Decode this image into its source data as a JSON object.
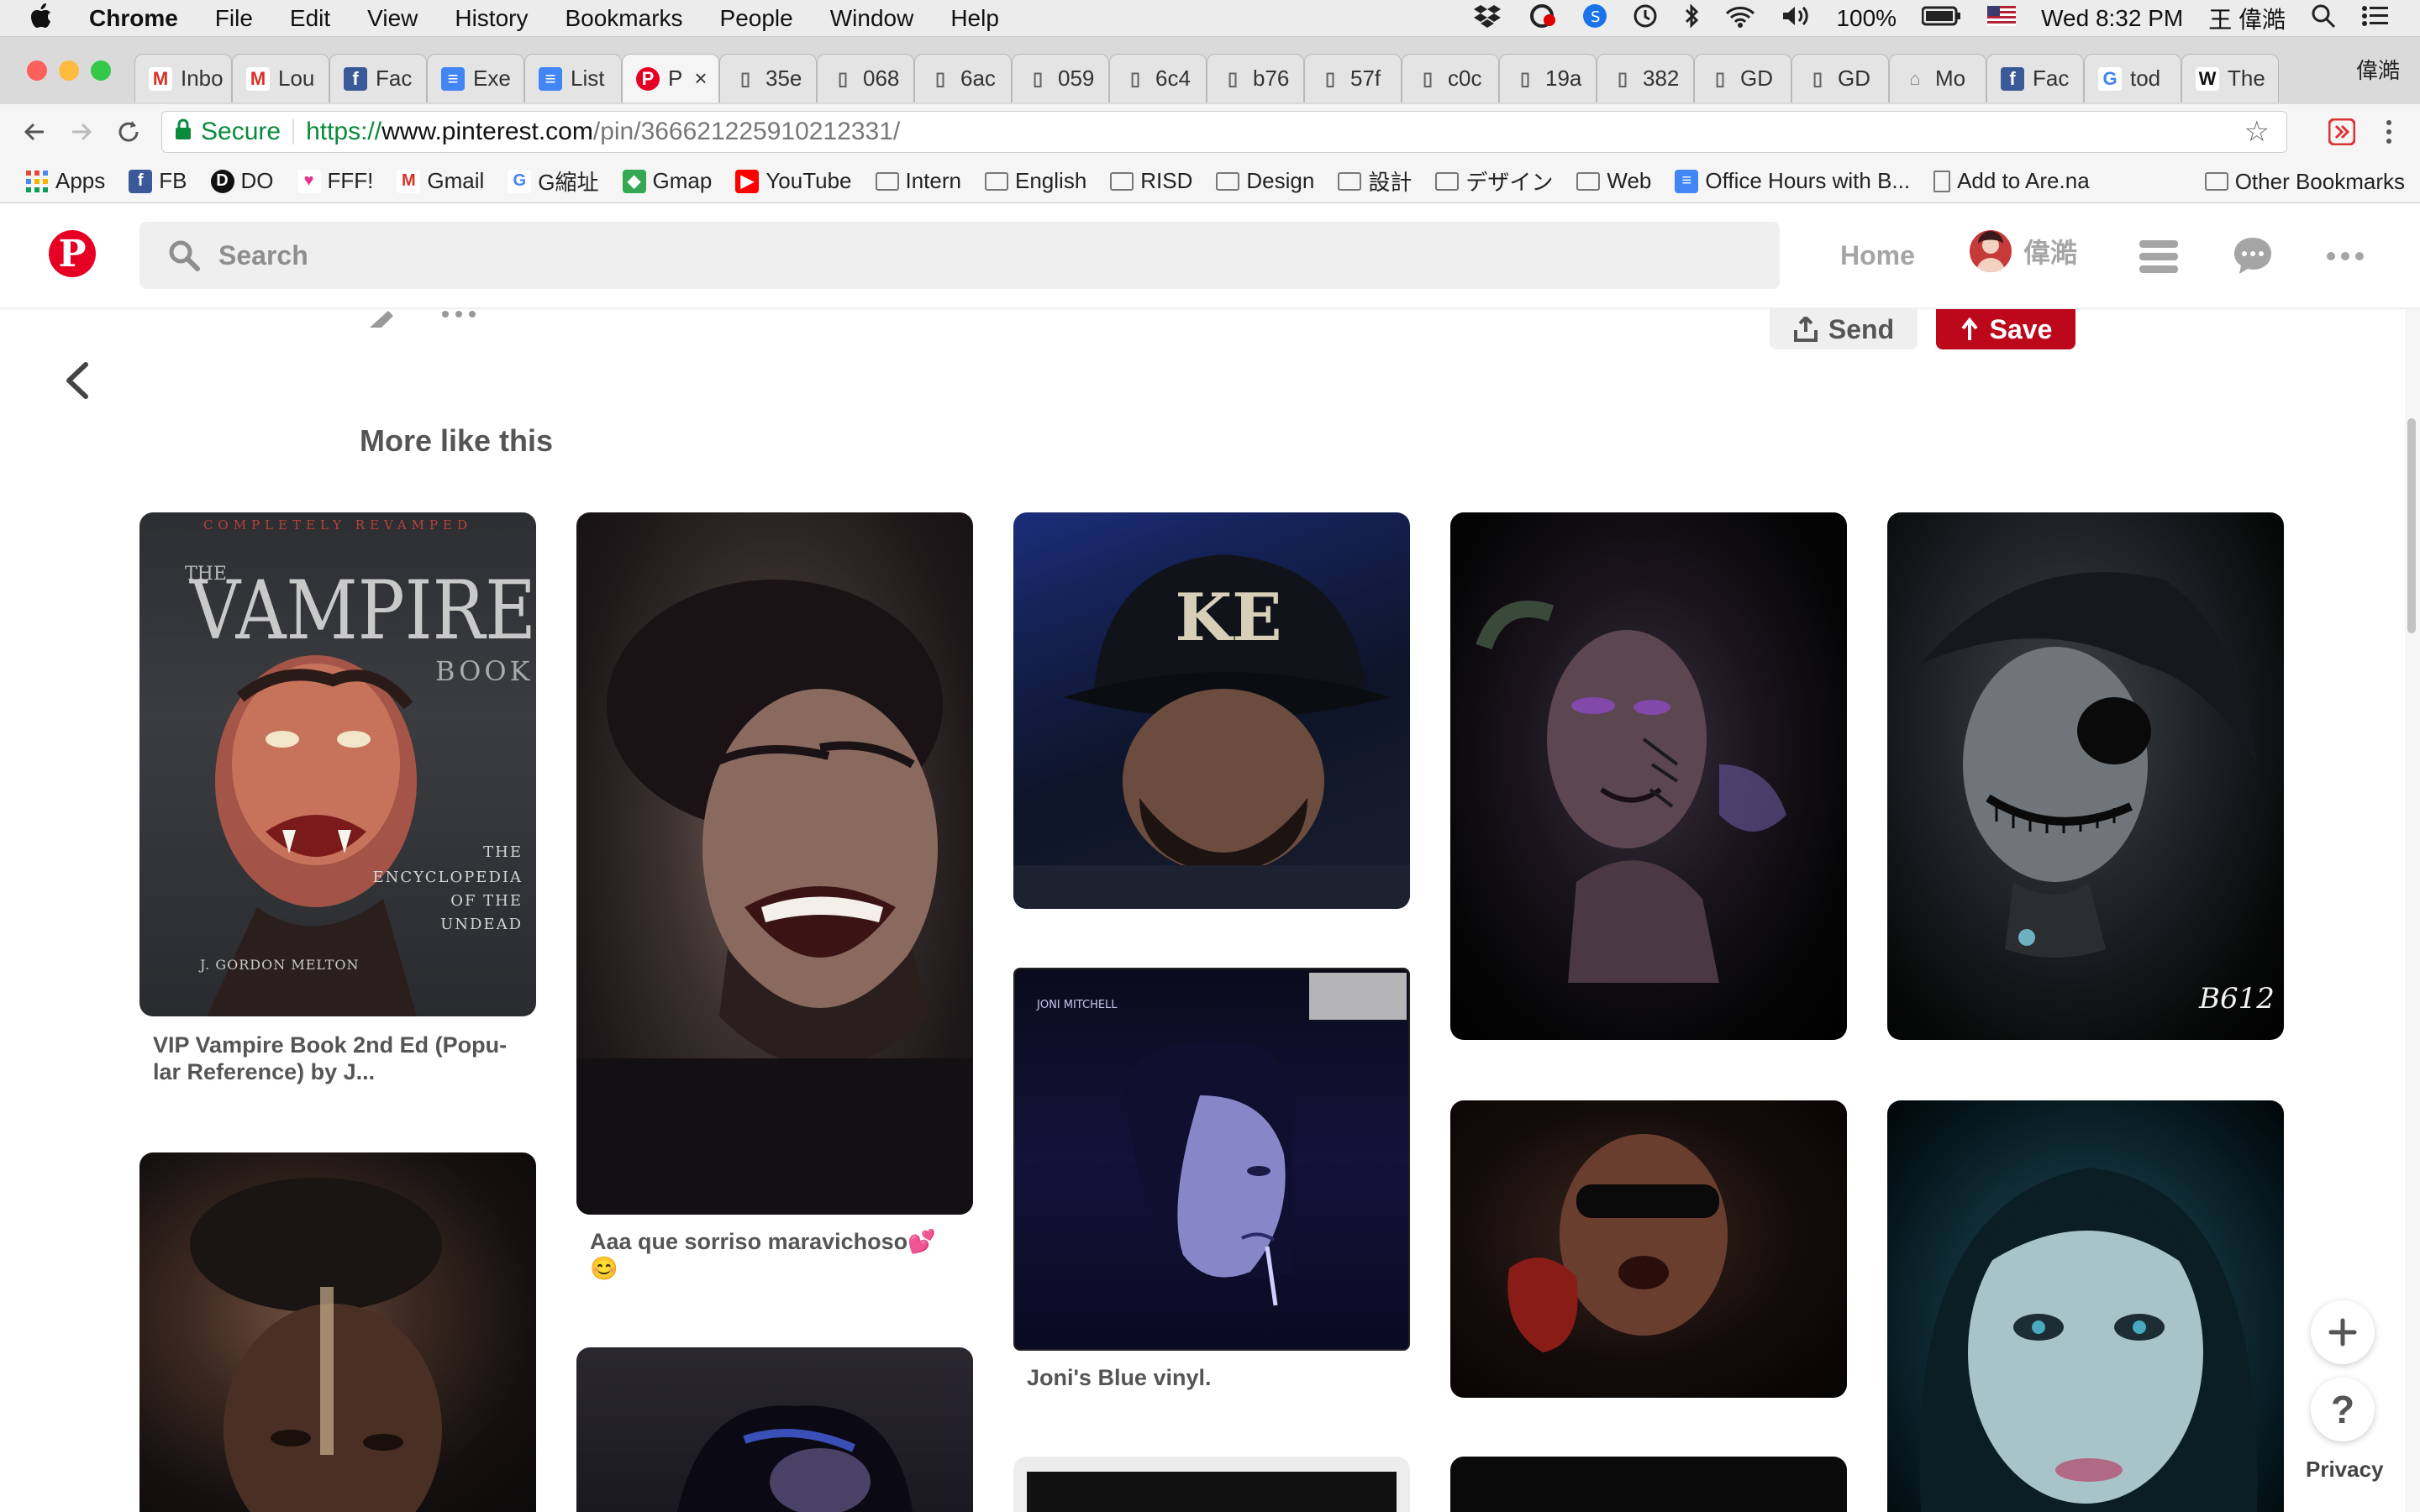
{
  "menubar": {
    "app_name": "Chrome",
    "menus": [
      "File",
      "Edit",
      "View",
      "History",
      "Bookmarks",
      "People",
      "Window",
      "Help"
    ],
    "battery": "100%",
    "clock": "Wed 8:32 PM",
    "user": "王 偉澔"
  },
  "tabs": [
    {
      "icon": "gmail-icon",
      "label": "Inbo"
    },
    {
      "icon": "gmail-icon",
      "label": "Lou"
    },
    {
      "icon": "facebook-icon",
      "label": "Fac"
    },
    {
      "icon": "docs-icon",
      "label": "Exe"
    },
    {
      "icon": "docs-icon",
      "label": "List"
    },
    {
      "icon": "pinterest-icon",
      "label": "P",
      "active": true
    },
    {
      "icon": "file-icon",
      "label": "35e"
    },
    {
      "icon": "file-icon",
      "label": "068"
    },
    {
      "icon": "file-icon",
      "label": "6ac"
    },
    {
      "icon": "file-icon",
      "label": "059"
    },
    {
      "icon": "file-icon",
      "label": "6c4"
    },
    {
      "icon": "file-icon",
      "label": "b76"
    },
    {
      "icon": "file-icon",
      "label": "57f"
    },
    {
      "icon": "file-icon",
      "label": "c0c"
    },
    {
      "icon": "file-icon",
      "label": "19a"
    },
    {
      "icon": "file-icon",
      "label": "382"
    },
    {
      "icon": "file-icon",
      "label": "GD"
    },
    {
      "icon": "file-icon",
      "label": "GD"
    },
    {
      "icon": "site-icon",
      "label": "Mo"
    },
    {
      "icon": "facebook-icon",
      "label": "Fac"
    },
    {
      "icon": "google-icon",
      "label": "tod"
    },
    {
      "icon": "wikipedia-icon",
      "label": "The"
    }
  ],
  "profile_name": "偉澔",
  "omnibox": {
    "secure_label": "Secure",
    "url_scheme": "https://",
    "url_host": "www.pinterest.com",
    "url_path": "/pin/366621225910212331/"
  },
  "bookmarks": [
    {
      "type": "apps",
      "label": "Apps"
    },
    {
      "type": "facebook",
      "label": "FB"
    },
    {
      "type": "do",
      "label": "DO"
    },
    {
      "type": "heart",
      "label": "FFF!"
    },
    {
      "type": "gmail",
      "label": "Gmail"
    },
    {
      "type": "google",
      "label": "G縮址"
    },
    {
      "type": "maps",
      "label": "Gmap"
    },
    {
      "type": "youtube",
      "label": "YouTube"
    },
    {
      "type": "folder",
      "label": "Intern"
    },
    {
      "type": "folder",
      "label": "English"
    },
    {
      "type": "folder",
      "label": "RISD"
    },
    {
      "type": "folder",
      "label": "Design"
    },
    {
      "type": "folder",
      "label": "設計"
    },
    {
      "type": "folder",
      "label": "デザイン"
    },
    {
      "type": "folder",
      "label": "Web"
    },
    {
      "type": "docs",
      "label": "Office Hours with B..."
    },
    {
      "type": "page",
      "label": "Add to Are.na"
    }
  ],
  "other_bookmarks": "Other Bookmarks",
  "pinterest": {
    "search_placeholder": "Search",
    "home_label": "Home",
    "user_label": "偉澔",
    "send_label": "Send",
    "save_label": "Save",
    "section_title": "More like this",
    "pins": [
      {
        "caption_lines": [
          "VIP Vampire Book 2nd Ed (Popu-",
          "lar Reference) by J..."
        ],
        "book_header": "COMPLETELY REVAMPED",
        "book_the": "THE",
        "book_title": "VAMPIRE",
        "book_sub": "BOOK",
        "book_desc": [
          "THE",
          "ENCYCLOPEDIA",
          "OF THE",
          "UNDEAD"
        ],
        "book_author": "J. GORDON MELTON"
      },
      {
        "caption_lines": [
          "Aaa que sorriso maravichoso💕",
          "😊"
        ]
      },
      {
        "caption_lines": [],
        "cap_text": "KE"
      },
      {
        "caption_lines": [
          "Joni's Blue vinyl."
        ],
        "album_artist": "JONI MITCHELL"
      },
      {
        "caption_lines": []
      },
      {
        "caption_lines": [],
        "signature": "B612"
      },
      {
        "caption_lines": []
      },
      {
        "caption_lines": []
      },
      {
        "caption_lines": []
      },
      {
        "caption_lines": []
      },
      {
        "caption_lines": []
      },
      {
        "caption_lines": []
      }
    ],
    "privacy_label": "Privacy"
  }
}
